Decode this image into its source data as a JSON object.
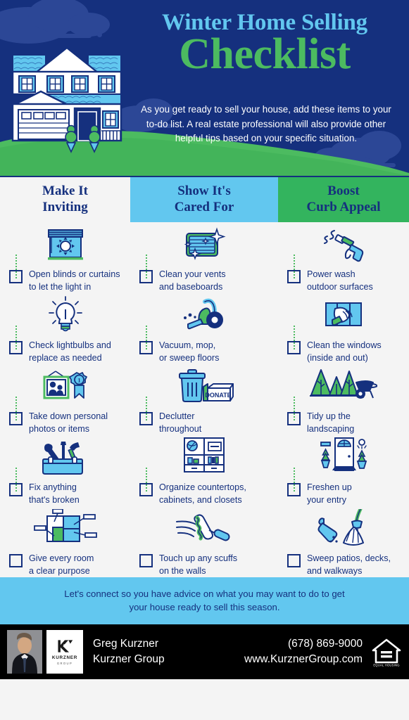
{
  "header": {
    "title_line1": "Winter Home Selling",
    "title_line2": "Checklist",
    "subtitle": "As you get ready to sell your house, add these items to your to-do list. A real estate professional will also provide other helpful tips based on your specific situation."
  },
  "columns": [
    {
      "heading_line1": "Make It",
      "heading_line2": "Inviting",
      "bg": "#f4f4f4",
      "text": "#15307e"
    },
    {
      "heading_line1": "Show It's",
      "heading_line2": "Cared For",
      "bg": "#62c7ef",
      "text": "#15307e"
    },
    {
      "heading_line1": "Boost",
      "heading_line2": "Curb Appeal",
      "bg": "#33b45e",
      "text": "#15307e"
    }
  ],
  "items": {
    "col1": [
      {
        "icon": "window-blinds-sun-icon",
        "line1": "Open blinds or curtains",
        "line2": "to let the light in"
      },
      {
        "icon": "lightbulb-icon",
        "line1": "Check lightbulbs and",
        "line2": "replace as needed"
      },
      {
        "icon": "photo-frame-award-icon",
        "line1": "Take down personal",
        "line2": "photos or items"
      },
      {
        "icon": "toolbox-tools-icon",
        "line1": "Fix anything",
        "line2": "that's broken"
      },
      {
        "icon": "floorplan-room-icon",
        "line1": "Give every room",
        "line2": "a clear purpose"
      }
    ],
    "col2": [
      {
        "icon": "vent-sparkle-icon",
        "line1": "Clean your vents",
        "line2": "and baseboards"
      },
      {
        "icon": "vacuum-cleaner-icon",
        "line1": "Vacuum, mop,",
        "line2": "or sweep floors"
      },
      {
        "icon": "trash-donate-box-icon",
        "line1": "Declutter",
        "line2": "throughout"
      },
      {
        "icon": "cabinet-shelves-icon",
        "line1": "Organize countertops,",
        "line2": "cabinets, and closets"
      },
      {
        "icon": "paint-roller-icon",
        "line1": "Touch up any scuffs",
        "line2": "on the walls"
      }
    ],
    "col3": [
      {
        "icon": "pressure-washer-icon",
        "line1": "Power wash",
        "line2": "outdoor surfaces"
      },
      {
        "icon": "window-cleaning-icon",
        "line1": "Clean the windows",
        "line2": "(inside and out)"
      },
      {
        "icon": "trees-wheelbarrow-icon",
        "line1": "Tidy up the",
        "line2": "landscaping"
      },
      {
        "icon": "front-door-plants-icon",
        "line1": "Freshen up",
        "line2": "your entry"
      },
      {
        "icon": "broom-dustpan-icon",
        "line1": "Sweep patios, decks,",
        "line2": "and walkways"
      }
    ]
  },
  "cta": {
    "line1": "Let's connect so you have advice on what you may want to do to get",
    "line2": "your house ready to sell this season."
  },
  "footer": {
    "agent_photo": "agent-headshot",
    "logo_mark": "kurzner-k-monogram",
    "logo_name": "KURZNER",
    "logo_group": "GROUP",
    "agent_name": "Greg Kurzner",
    "company": "Kurzner Group",
    "phone": "(678) 869-9000",
    "website": "www.KurznerGroup.com",
    "eho_badge": "equal-housing-opportunity-icon",
    "eho_caption": "EQUAL HOUSING OPPORTUNITY"
  },
  "colors": {
    "navy": "#15307e",
    "light_blue": "#62c7ef",
    "green": "#33b45e",
    "title_green": "#4cbb60",
    "page_bg": "#f4f4f4",
    "footer_bg": "#000000",
    "cloud": "#2c4796"
  }
}
